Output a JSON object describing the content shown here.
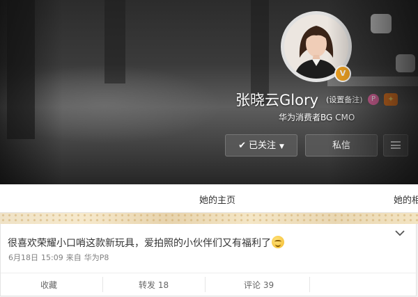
{
  "profile": {
    "name": "张晓云Glory",
    "remark_link": "(设置备注)",
    "title": "华为消费者BG CMO",
    "vbadge": "V",
    "pill_icon": "P",
    "vip_icon": "✦"
  },
  "actions": {
    "follow_label": "已关注",
    "check_glyph": "✔",
    "caret_glyph": "▼",
    "message_label": "私信"
  },
  "tabs": {
    "home": "她的主页",
    "album": "她的相"
  },
  "post": {
    "text": "很喜欢荣耀小口哨这款新玩具，爱拍照的小伙伴们又有福利了",
    "date": "6月18日",
    "time": "15:09",
    "source_prefix": "来自",
    "source": "华为P8",
    "favorite_label": "收藏",
    "forward_label": "转发 18",
    "comment_label": "评论 39"
  },
  "colors": {
    "accent_orange": "#f5a623",
    "pink_icon": "#e86aa5",
    "text_dark": "#333333",
    "text_meta": "#808080"
  }
}
